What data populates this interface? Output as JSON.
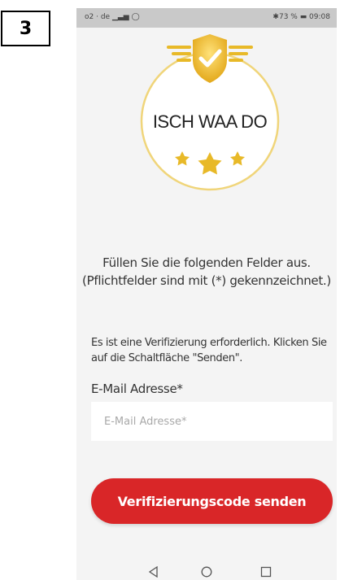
{
  "figure_label": "3",
  "status_bar": {
    "carrier": "o2 · de",
    "right": "✱73 % ▬ 09:08"
  },
  "badge": {
    "text": "ISCH WAA DO"
  },
  "instructions": {
    "line1": "Füllen Sie die folgenden Felder aus.",
    "line2": "(Pflichtfelder sind mit (*) gekennzeichnet.)"
  },
  "verify_note": "Es ist eine Verifizierung erforderlich. Klicken Sie auf die Schaltfläche \"Senden\".",
  "email": {
    "label": "E-Mail Adresse*",
    "placeholder": "E-Mail Adresse*",
    "value": ""
  },
  "send_button": {
    "label": "Verifizierungscode senden"
  },
  "colors": {
    "accent": "#d92628",
    "gold": "#e8b928",
    "background": "#f4f4f4"
  },
  "navigation": {
    "icons": [
      "back-triangle-icon",
      "home-circle-icon",
      "recents-square-icon"
    ]
  }
}
